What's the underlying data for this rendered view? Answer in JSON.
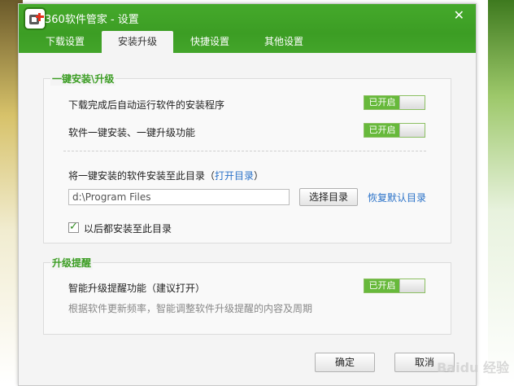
{
  "window": {
    "title": "360软件管家 - 设置",
    "close_label": "✕"
  },
  "tabs": [
    {
      "label": "下载设置",
      "active": false
    },
    {
      "label": "安装升级",
      "active": true
    },
    {
      "label": "快捷设置",
      "active": false
    },
    {
      "label": "其他设置",
      "active": false
    }
  ],
  "install_group": {
    "title": "一键安装\\升级",
    "option1": {
      "label": "下载完成后自动运行软件的安装程序",
      "state": "已开启"
    },
    "option2": {
      "label": "软件一键安装、一键升级功能",
      "state": "已开启"
    },
    "dir_label_prefix": "将一键安装的软件安装至此目录（",
    "open_dir_link": "打开目录",
    "dir_label_suffix": "）",
    "path_value": "d:\\Program Files",
    "choose_dir_button": "选择目录",
    "restore_default_link": "恢复默认目录",
    "always_install_checkbox": {
      "label": "以后都安装至此目录",
      "checked": true
    }
  },
  "upgrade_group": {
    "title": "升级提醒",
    "option": {
      "label": "智能升级提醒功能（建议打开）",
      "state": "已开启"
    },
    "hint": "根据软件更新频率，智能调整软件升级提醒的内容及周期"
  },
  "footer": {
    "ok_button": "确定",
    "cancel_button": "取消"
  },
  "watermark": "Baidu 经验",
  "colors": {
    "accent": "#3c9d24",
    "toggle_on": "#67b93b",
    "link": "#2a72c8"
  }
}
